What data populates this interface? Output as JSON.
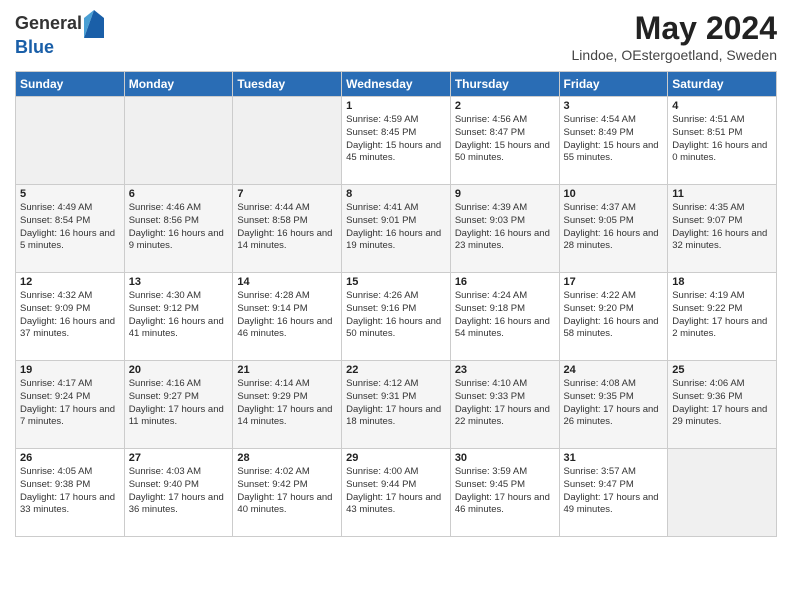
{
  "logo": {
    "general": "General",
    "blue": "Blue"
  },
  "header": {
    "month_year": "May 2024",
    "location": "Lindoe, OEstergoetland, Sweden"
  },
  "days_of_week": [
    "Sunday",
    "Monday",
    "Tuesday",
    "Wednesday",
    "Thursday",
    "Friday",
    "Saturday"
  ],
  "weeks": [
    [
      {
        "day": "",
        "sunrise": "",
        "sunset": "",
        "daylight": "",
        "empty": true
      },
      {
        "day": "",
        "sunrise": "",
        "sunset": "",
        "daylight": "",
        "empty": true
      },
      {
        "day": "",
        "sunrise": "",
        "sunset": "",
        "daylight": "",
        "empty": true
      },
      {
        "day": "1",
        "sunrise": "Sunrise: 4:59 AM",
        "sunset": "Sunset: 8:45 PM",
        "daylight": "Daylight: 15 hours and 45 minutes.",
        "empty": false
      },
      {
        "day": "2",
        "sunrise": "Sunrise: 4:56 AM",
        "sunset": "Sunset: 8:47 PM",
        "daylight": "Daylight: 15 hours and 50 minutes.",
        "empty": false
      },
      {
        "day": "3",
        "sunrise": "Sunrise: 4:54 AM",
        "sunset": "Sunset: 8:49 PM",
        "daylight": "Daylight: 15 hours and 55 minutes.",
        "empty": false
      },
      {
        "day": "4",
        "sunrise": "Sunrise: 4:51 AM",
        "sunset": "Sunset: 8:51 PM",
        "daylight": "Daylight: 16 hours and 0 minutes.",
        "empty": false
      }
    ],
    [
      {
        "day": "5",
        "sunrise": "Sunrise: 4:49 AM",
        "sunset": "Sunset: 8:54 PM",
        "daylight": "Daylight: 16 hours and 5 minutes.",
        "empty": false
      },
      {
        "day": "6",
        "sunrise": "Sunrise: 4:46 AM",
        "sunset": "Sunset: 8:56 PM",
        "daylight": "Daylight: 16 hours and 9 minutes.",
        "empty": false
      },
      {
        "day": "7",
        "sunrise": "Sunrise: 4:44 AM",
        "sunset": "Sunset: 8:58 PM",
        "daylight": "Daylight: 16 hours and 14 minutes.",
        "empty": false
      },
      {
        "day": "8",
        "sunrise": "Sunrise: 4:41 AM",
        "sunset": "Sunset: 9:01 PM",
        "daylight": "Daylight: 16 hours and 19 minutes.",
        "empty": false
      },
      {
        "day": "9",
        "sunrise": "Sunrise: 4:39 AM",
        "sunset": "Sunset: 9:03 PM",
        "daylight": "Daylight: 16 hours and 23 minutes.",
        "empty": false
      },
      {
        "day": "10",
        "sunrise": "Sunrise: 4:37 AM",
        "sunset": "Sunset: 9:05 PM",
        "daylight": "Daylight: 16 hours and 28 minutes.",
        "empty": false
      },
      {
        "day": "11",
        "sunrise": "Sunrise: 4:35 AM",
        "sunset": "Sunset: 9:07 PM",
        "daylight": "Daylight: 16 hours and 32 minutes.",
        "empty": false
      }
    ],
    [
      {
        "day": "12",
        "sunrise": "Sunrise: 4:32 AM",
        "sunset": "Sunset: 9:09 PM",
        "daylight": "Daylight: 16 hours and 37 minutes.",
        "empty": false
      },
      {
        "day": "13",
        "sunrise": "Sunrise: 4:30 AM",
        "sunset": "Sunset: 9:12 PM",
        "daylight": "Daylight: 16 hours and 41 minutes.",
        "empty": false
      },
      {
        "day": "14",
        "sunrise": "Sunrise: 4:28 AM",
        "sunset": "Sunset: 9:14 PM",
        "daylight": "Daylight: 16 hours and 46 minutes.",
        "empty": false
      },
      {
        "day": "15",
        "sunrise": "Sunrise: 4:26 AM",
        "sunset": "Sunset: 9:16 PM",
        "daylight": "Daylight: 16 hours and 50 minutes.",
        "empty": false
      },
      {
        "day": "16",
        "sunrise": "Sunrise: 4:24 AM",
        "sunset": "Sunset: 9:18 PM",
        "daylight": "Daylight: 16 hours and 54 minutes.",
        "empty": false
      },
      {
        "day": "17",
        "sunrise": "Sunrise: 4:22 AM",
        "sunset": "Sunset: 9:20 PM",
        "daylight": "Daylight: 16 hours and 58 minutes.",
        "empty": false
      },
      {
        "day": "18",
        "sunrise": "Sunrise: 4:19 AM",
        "sunset": "Sunset: 9:22 PM",
        "daylight": "Daylight: 17 hours and 2 minutes.",
        "empty": false
      }
    ],
    [
      {
        "day": "19",
        "sunrise": "Sunrise: 4:17 AM",
        "sunset": "Sunset: 9:24 PM",
        "daylight": "Daylight: 17 hours and 7 minutes.",
        "empty": false
      },
      {
        "day": "20",
        "sunrise": "Sunrise: 4:16 AM",
        "sunset": "Sunset: 9:27 PM",
        "daylight": "Daylight: 17 hours and 11 minutes.",
        "empty": false
      },
      {
        "day": "21",
        "sunrise": "Sunrise: 4:14 AM",
        "sunset": "Sunset: 9:29 PM",
        "daylight": "Daylight: 17 hours and 14 minutes.",
        "empty": false
      },
      {
        "day": "22",
        "sunrise": "Sunrise: 4:12 AM",
        "sunset": "Sunset: 9:31 PM",
        "daylight": "Daylight: 17 hours and 18 minutes.",
        "empty": false
      },
      {
        "day": "23",
        "sunrise": "Sunrise: 4:10 AM",
        "sunset": "Sunset: 9:33 PM",
        "daylight": "Daylight: 17 hours and 22 minutes.",
        "empty": false
      },
      {
        "day": "24",
        "sunrise": "Sunrise: 4:08 AM",
        "sunset": "Sunset: 9:35 PM",
        "daylight": "Daylight: 17 hours and 26 minutes.",
        "empty": false
      },
      {
        "day": "25",
        "sunrise": "Sunrise: 4:06 AM",
        "sunset": "Sunset: 9:36 PM",
        "daylight": "Daylight: 17 hours and 29 minutes.",
        "empty": false
      }
    ],
    [
      {
        "day": "26",
        "sunrise": "Sunrise: 4:05 AM",
        "sunset": "Sunset: 9:38 PM",
        "daylight": "Daylight: 17 hours and 33 minutes.",
        "empty": false
      },
      {
        "day": "27",
        "sunrise": "Sunrise: 4:03 AM",
        "sunset": "Sunset: 9:40 PM",
        "daylight": "Daylight: 17 hours and 36 minutes.",
        "empty": false
      },
      {
        "day": "28",
        "sunrise": "Sunrise: 4:02 AM",
        "sunset": "Sunset: 9:42 PM",
        "daylight": "Daylight: 17 hours and 40 minutes.",
        "empty": false
      },
      {
        "day": "29",
        "sunrise": "Sunrise: 4:00 AM",
        "sunset": "Sunset: 9:44 PM",
        "daylight": "Daylight: 17 hours and 43 minutes.",
        "empty": false
      },
      {
        "day": "30",
        "sunrise": "Sunrise: 3:59 AM",
        "sunset": "Sunset: 9:45 PM",
        "daylight": "Daylight: 17 hours and 46 minutes.",
        "empty": false
      },
      {
        "day": "31",
        "sunrise": "Sunrise: 3:57 AM",
        "sunset": "Sunset: 9:47 PM",
        "daylight": "Daylight: 17 hours and 49 minutes.",
        "empty": false
      },
      {
        "day": "",
        "sunrise": "",
        "sunset": "",
        "daylight": "",
        "empty": true
      }
    ]
  ]
}
